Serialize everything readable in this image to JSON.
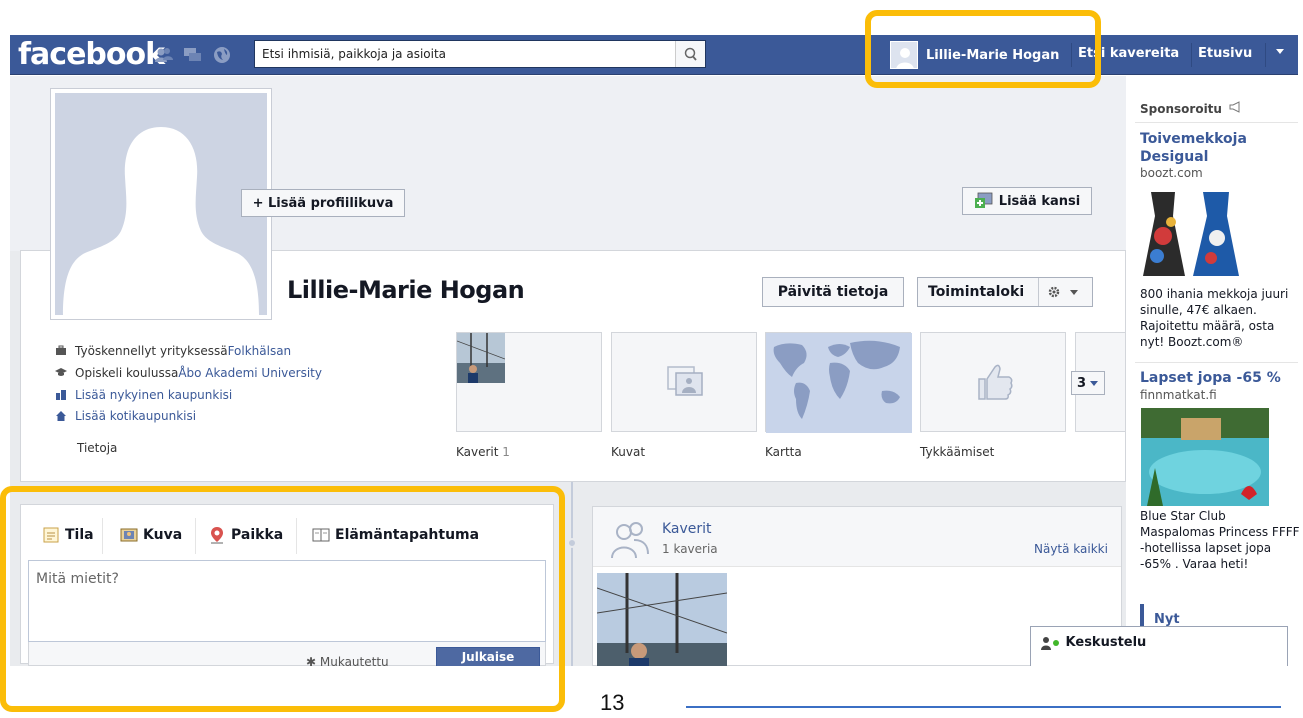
{
  "topbar": {
    "logo": "facebook",
    "search_placeholder": "Etsi ihmisiä, paikkoja ja asioita",
    "user_name": "Lillie-Marie Hogan",
    "find_friends": "Etsi kavereita",
    "home": "Etusivu",
    "jewels": [
      "friend-requests-icon",
      "messages-icon",
      "notifications-globe-icon"
    ]
  },
  "profile": {
    "add_profile_pic": "+ Lisää profiilikuva",
    "add_cover": "Lisää kansi",
    "name": "Lillie-Marie Hogan",
    "update_info": "Päivitä tietoja",
    "activity_log": "Toimintaloki",
    "info_items": [
      {
        "icon": "briefcase-icon",
        "prefix": "Työskennellyt yrityksessä ",
        "link": "Folkhälsan"
      },
      {
        "icon": "graduation-cap-icon",
        "prefix": "Opiskeli koulussa ",
        "link": "Åbo Akademi University"
      },
      {
        "icon": "city-icon",
        "prefix": "",
        "link": "Lisää nykyinen kaupunkisi"
      },
      {
        "icon": "home-icon",
        "prefix": "",
        "link": "Lisää kotikaupunkisi"
      }
    ],
    "about_label": "Tietoja",
    "tiles": [
      {
        "label": "Kaverit",
        "count": "1"
      },
      {
        "label": "Kuvat",
        "count": ""
      },
      {
        "label": "Kartta",
        "count": ""
      },
      {
        "label": "Tykkäämiset",
        "count": ""
      }
    ],
    "more_count": "3"
  },
  "composer": {
    "tabs": [
      "Tila",
      "Kuva",
      "Paikka",
      "Elämäntapahtuma"
    ],
    "placeholder": "Mitä mietit?",
    "privacy": "Mukautettu",
    "post_button": "Julkaise"
  },
  "friends_box": {
    "title": "Kaverit",
    "subtitle": "1 kaveria",
    "see_all": "Näytä kaikki"
  },
  "sidebar": {
    "sponsored": "Sponsoroitu",
    "ads": [
      {
        "title": "Toivemekkoja Desigual",
        "domain": "boozt.com",
        "text": "800 ihania mekkoja juuri sinulle, 47€ alkaen. Rajoitettu määrä, osta nyt! Boozt.com®"
      },
      {
        "title": "Lapset jopa -65 %",
        "domain": "finnmatkat.fi",
        "text": "Blue Star Club Maspalomas Princess FFFF -hotellissa lapset jopa -65% . Varaa heti!"
      }
    ],
    "now_label": "Nyt",
    "chat_label": "Keskustelu"
  },
  "slide": {
    "page_number": "13"
  },
  "colors": {
    "brand": "#3b5998",
    "highlight": "#fbbd08"
  }
}
